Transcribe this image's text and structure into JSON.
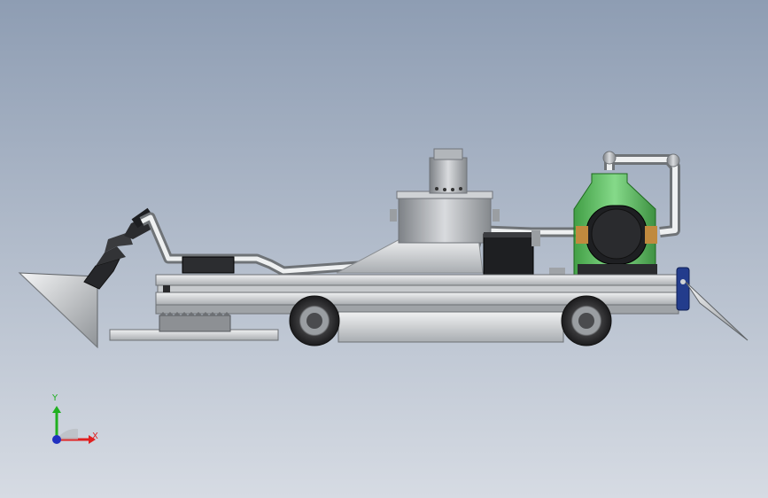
{
  "viewport": {
    "background_top": "#8e9db3",
    "background_bottom": "#d6dbe3"
  },
  "model": {
    "colors": {
      "metal_light": "#e4e6e8",
      "metal_mid": "#b8bcc0",
      "metal_dark": "#6e7276",
      "motor_black": "#1e1f22",
      "tank_green": "#3fbf3f",
      "bracket_blue": "#233c8c",
      "tire_dark": "#2a2a2c",
      "gear_gray": "#8d9094"
    }
  },
  "triad": {
    "x_label": "X",
    "y_label": "Y",
    "x_color": "#e02020",
    "y_color": "#20b020",
    "z_color": "#2030c0"
  }
}
